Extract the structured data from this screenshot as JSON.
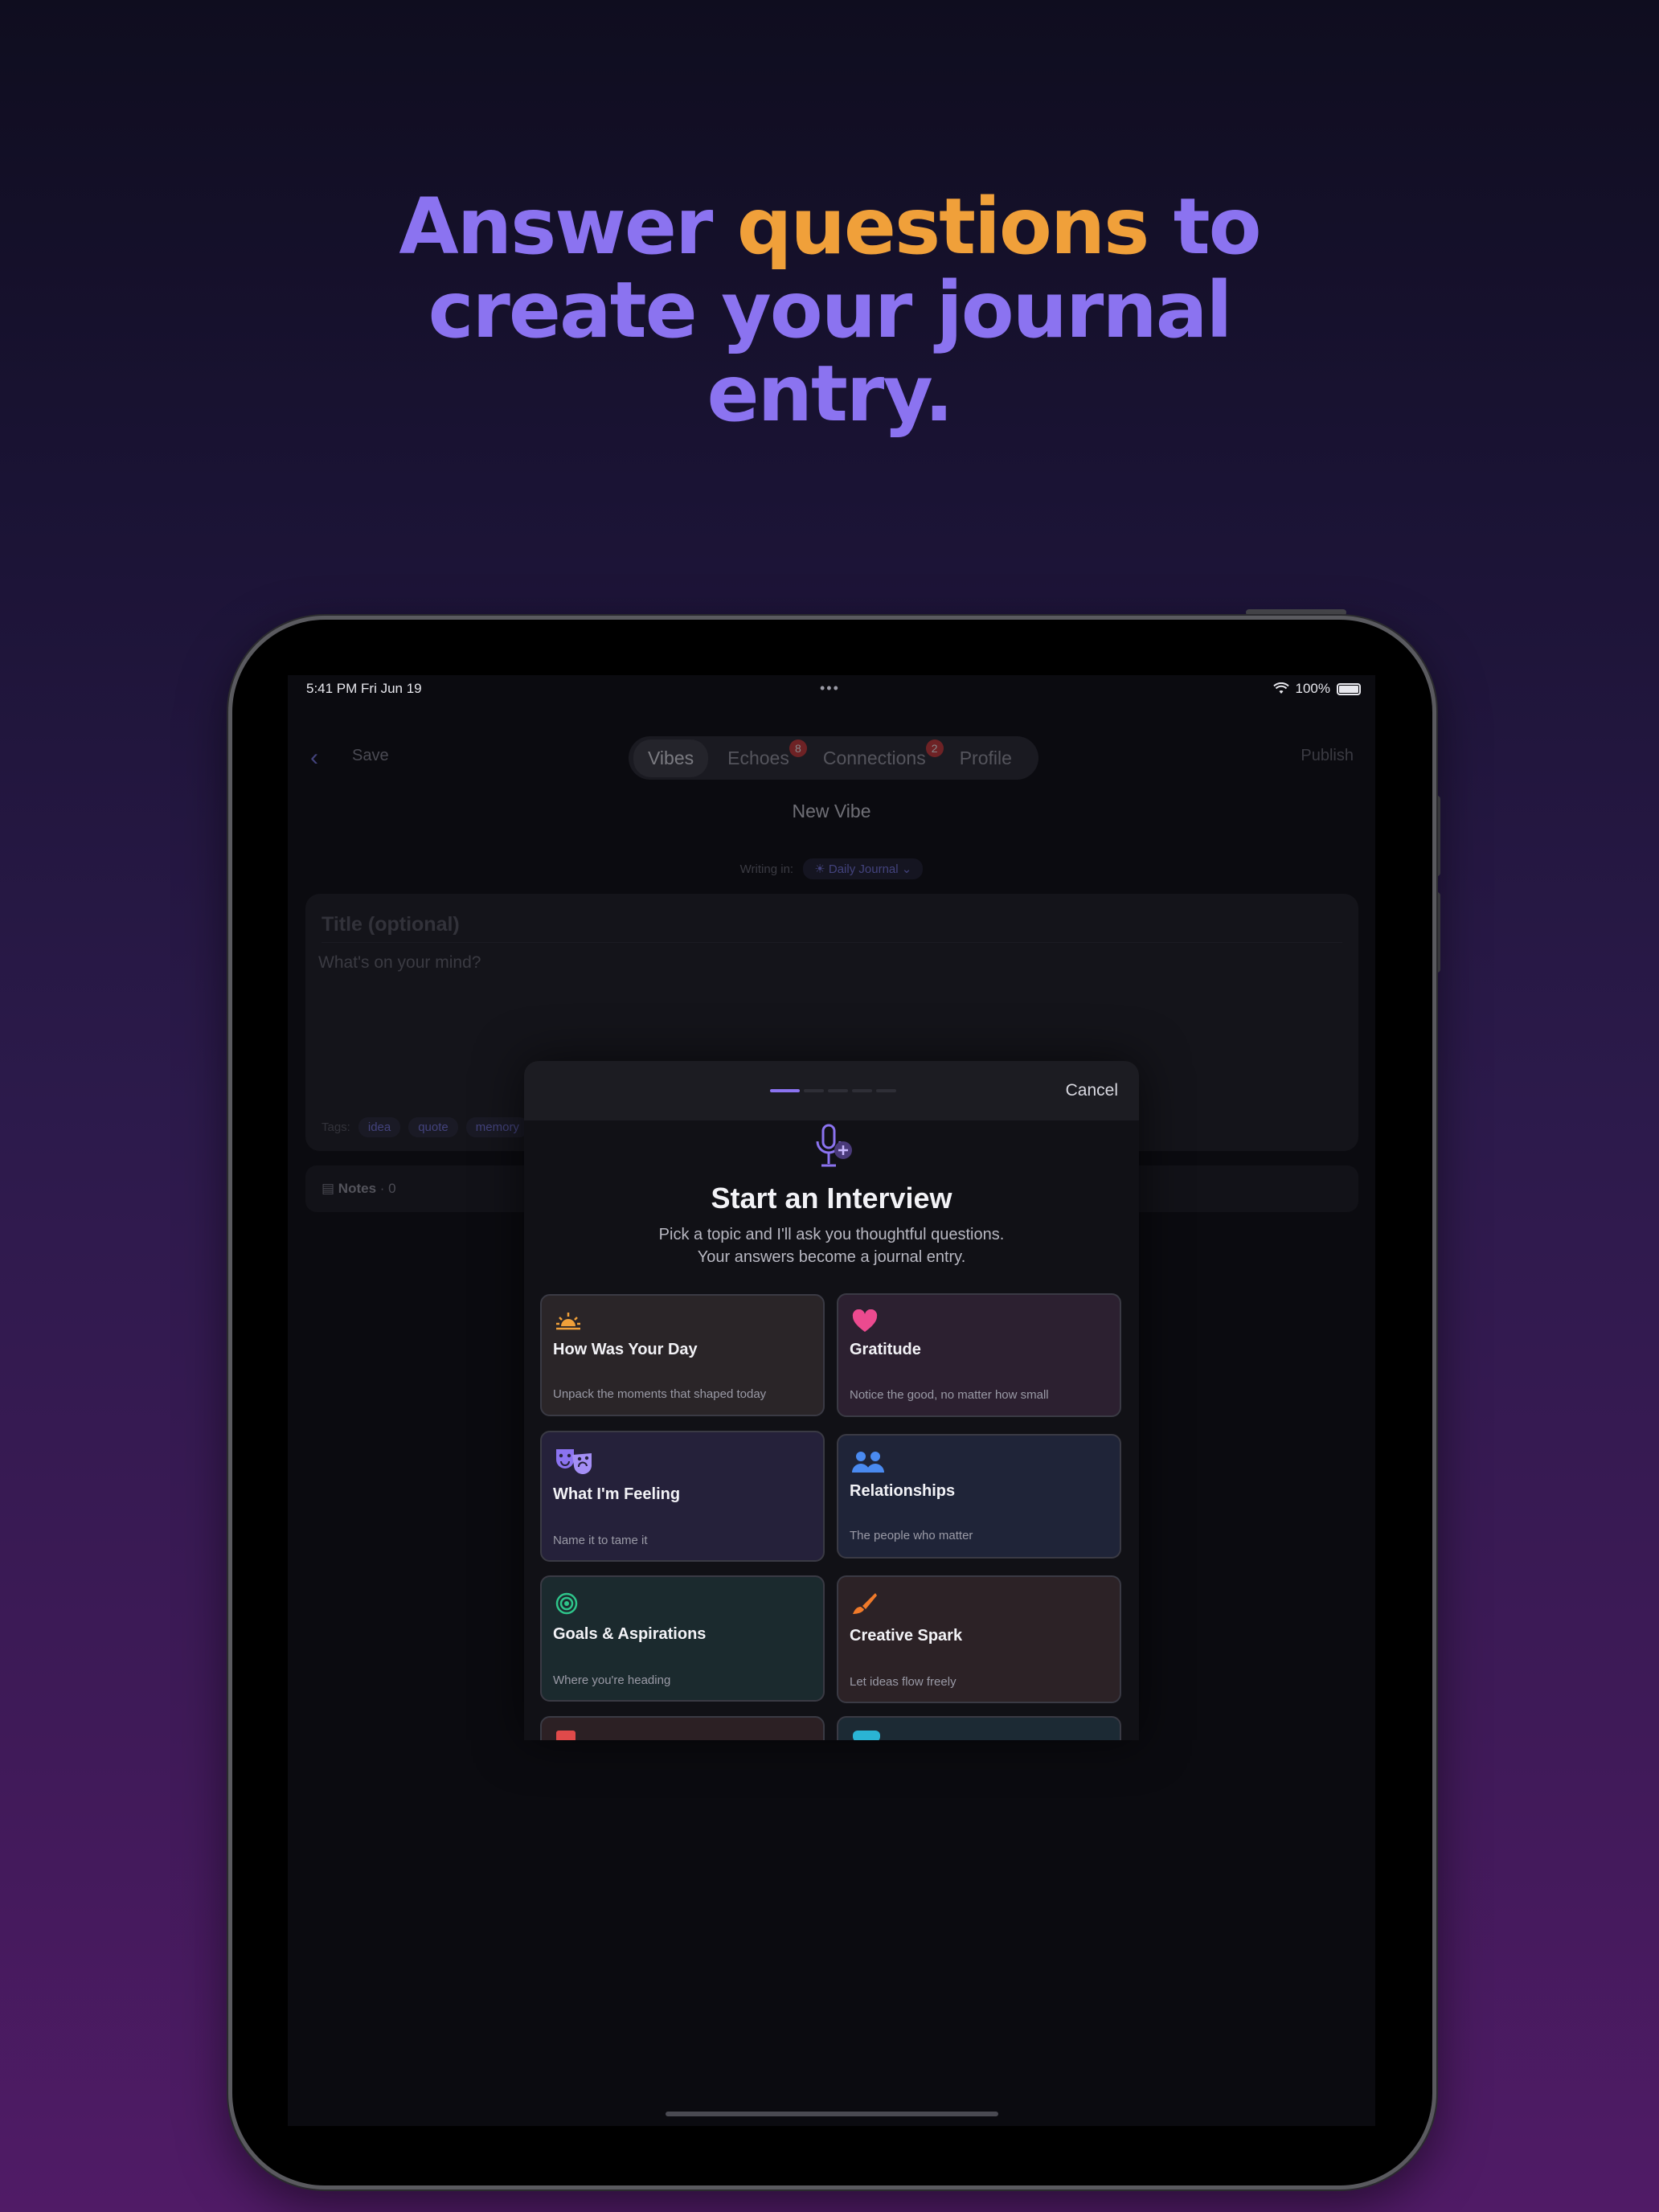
{
  "headline": {
    "part1": "Answer ",
    "highlight": "questions",
    "part2": " to",
    "line2": "create your journal",
    "line3": "entry."
  },
  "status_bar": {
    "time": "5:41 PM   Fri Jun 19",
    "dots": "•••",
    "battery": "100%"
  },
  "nav": {
    "save": "Save",
    "publish": "Publish",
    "back_icon": "chevron-left-icon"
  },
  "tabs": [
    {
      "label": "Vibes",
      "active": true
    },
    {
      "label": "Echoes",
      "badge": "8"
    },
    {
      "label": "Connections",
      "badge": "2"
    },
    {
      "label": "Profile"
    }
  ],
  "page_title": "New Vibe",
  "writing_in": {
    "label": "Writing in:",
    "journal": "☀ Daily Journal ⌄"
  },
  "editor": {
    "title_placeholder": "Title (optional)",
    "body_placeholder": "What's on your mind?",
    "tags_label": "Tags:",
    "tags": [
      "idea",
      "quote",
      "memory"
    ]
  },
  "notes": {
    "label": "Notes",
    "count": "· 0"
  },
  "sheet": {
    "cancel": "Cancel",
    "title": "Start an Interview",
    "subtitle_line1": "Pick a topic and I'll ask you thoughtful questions.",
    "subtitle_line2": "Your answers become a journal entry.",
    "topics": [
      {
        "title": "How Was Your Day",
        "desc": "Unpack the moments that shaped today",
        "icon": "sunrise-icon",
        "color": "#f0a03a"
      },
      {
        "title": "Gratitude",
        "desc": "Notice the good, no matter how small",
        "icon": "heart-icon",
        "color": "#ec4a8f"
      },
      {
        "title": "What I'm Feeling",
        "desc": "Name it to tame it",
        "icon": "theater-masks-icon",
        "color": "#8b73f0"
      },
      {
        "title": "Relationships",
        "desc": "The people who matter",
        "icon": "people-icon",
        "color": "#4a8af0"
      },
      {
        "title": "Goals & Aspirations",
        "desc": "Where you're heading",
        "icon": "target-icon",
        "color": "#2ec48a"
      },
      {
        "title": "Creative Spark",
        "desc": "Let ideas flow freely",
        "icon": "paintbrush-icon",
        "color": "#f07a2a"
      }
    ]
  }
}
